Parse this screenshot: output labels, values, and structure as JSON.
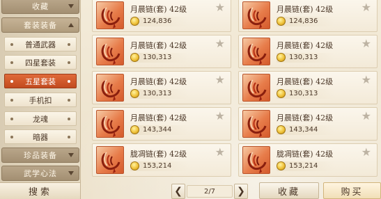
{
  "sidebar": {
    "categories": [
      {
        "label": "收藏",
        "state": "collapsed"
      },
      {
        "label": "套装装备",
        "state": "expanded"
      },
      {
        "label": "珍品装备",
        "state": "collapsed"
      },
      {
        "label": "武学心法",
        "state": "collapsed"
      }
    ],
    "sub_items": [
      {
        "label": "普通武器",
        "active": false
      },
      {
        "label": "四星套装",
        "active": false
      },
      {
        "label": "五星套装",
        "active": true
      },
      {
        "label": "手机扣",
        "active": false
      },
      {
        "label": "龙魂",
        "active": false
      },
      {
        "label": "暗器",
        "active": false
      }
    ],
    "search_label": "搜索"
  },
  "items": [
    {
      "name": "月晨链(套) 42级",
      "price": "124,836"
    },
    {
      "name": "月晨链(套) 42级",
      "price": "124,836"
    },
    {
      "name": "月晨链(套) 42级",
      "price": "130,313"
    },
    {
      "name": "月晨链(套) 42级",
      "price": "130,313"
    },
    {
      "name": "月晨链(套) 42级",
      "price": "130,313"
    },
    {
      "name": "月晨链(套) 42级",
      "price": "130,313"
    },
    {
      "name": "月晨链(套) 42级",
      "price": "143,344"
    },
    {
      "name": "月晨链(套) 42级",
      "price": "143,344"
    },
    {
      "name": "胧凋链(套) 42级",
      "price": "153,214"
    },
    {
      "name": "胧凋链(套) 42级",
      "price": "153,214"
    }
  ],
  "pager": {
    "prev": "❮",
    "next": "❯",
    "page": "2/7"
  },
  "actions": {
    "favorite_label": "收藏",
    "buy_label": "购买"
  },
  "icons": {
    "favorite_star": "star-icon",
    "currency": "gold-coin-icon",
    "item": "necklace-icon"
  },
  "colors": {
    "active_tab": "#d45a2c",
    "star": "#bdb3a3",
    "coin": "#f0c23a"
  }
}
